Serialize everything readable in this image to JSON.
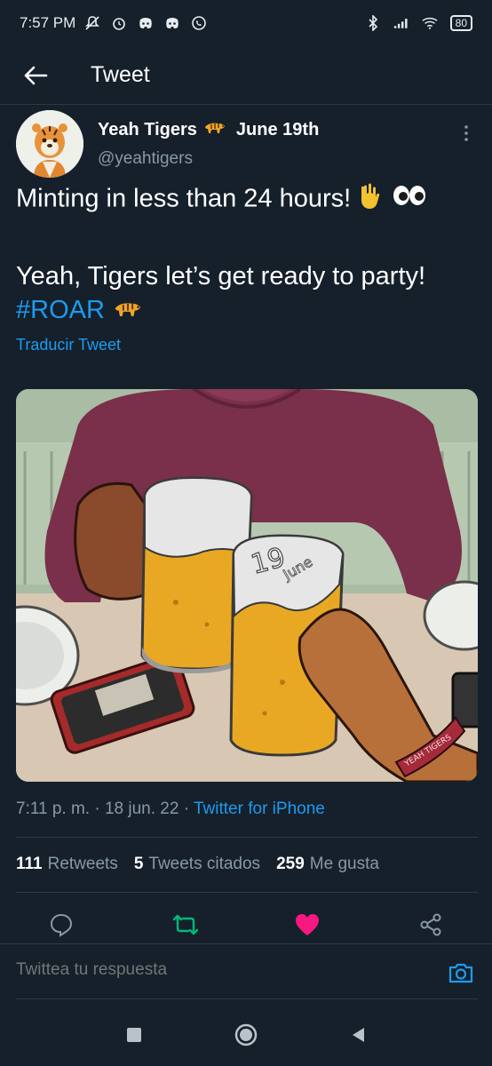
{
  "status_bar": {
    "time": "7:57 PM",
    "battery": "80"
  },
  "header": {
    "title": "Tweet"
  },
  "author": {
    "name": "Yeah Tigers",
    "date": "June 19th",
    "handle": "@yeahtigers"
  },
  "tweet": {
    "line1": "Minting in less than 24 hours!",
    "line2": "Yeah, Tigers let’s get ready to party!",
    "hashtag": "#ROAR",
    "translate": "Traducir Tweet"
  },
  "media": {
    "jar_number": "19",
    "jar_label": "June",
    "wristband": "YEAH TIGERS"
  },
  "meta": {
    "time": "7:11 p. m.",
    "date": "18 jun. 22",
    "source": "Twitter for iPhone"
  },
  "stats": {
    "retweets_count": "111",
    "retweets_label": "Retweets",
    "quotes_count": "5",
    "quotes_label": "Tweets citados",
    "likes_count": "259",
    "likes_label": "Me gusta"
  },
  "reply": {
    "placeholder": "Twittea tu respuesta"
  },
  "colors": {
    "background": "#15202b",
    "accent": "#1d9bf0",
    "like": "#f91880",
    "retweet": "#00ba7c",
    "muted": "#8899a6"
  }
}
